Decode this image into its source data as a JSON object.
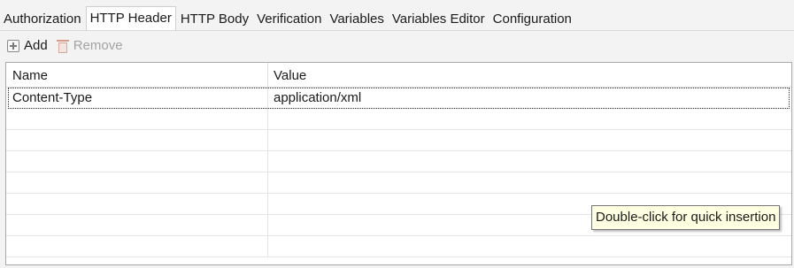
{
  "tabs": [
    {
      "label": "Authorization",
      "active": false
    },
    {
      "label": "HTTP Header",
      "active": true
    },
    {
      "label": "HTTP Body",
      "active": false
    },
    {
      "label": "Verification",
      "active": false
    },
    {
      "label": "Variables",
      "active": false
    },
    {
      "label": "Variables Editor",
      "active": false
    },
    {
      "label": "Configuration",
      "active": false
    }
  ],
  "toolbar": {
    "add_label": "Add",
    "add_icon": "add-icon",
    "remove_label": "Remove",
    "remove_icon": "trash-icon",
    "remove_enabled": false
  },
  "table": {
    "columns": [
      "Name",
      "Value"
    ],
    "rows": [
      {
        "name": "Content-Type",
        "value": "application/xml",
        "selected": true
      },
      {
        "name": "",
        "value": ""
      },
      {
        "name": "",
        "value": ""
      },
      {
        "name": "",
        "value": ""
      },
      {
        "name": "",
        "value": ""
      },
      {
        "name": "",
        "value": ""
      },
      {
        "name": "",
        "value": ""
      },
      {
        "name": "",
        "value": ""
      }
    ]
  },
  "tooltip": {
    "text": "Double-click for quick insertion"
  },
  "colors": {
    "tooltip_bg": "#ffffe1",
    "disabled_text": "#a3a3a3"
  }
}
